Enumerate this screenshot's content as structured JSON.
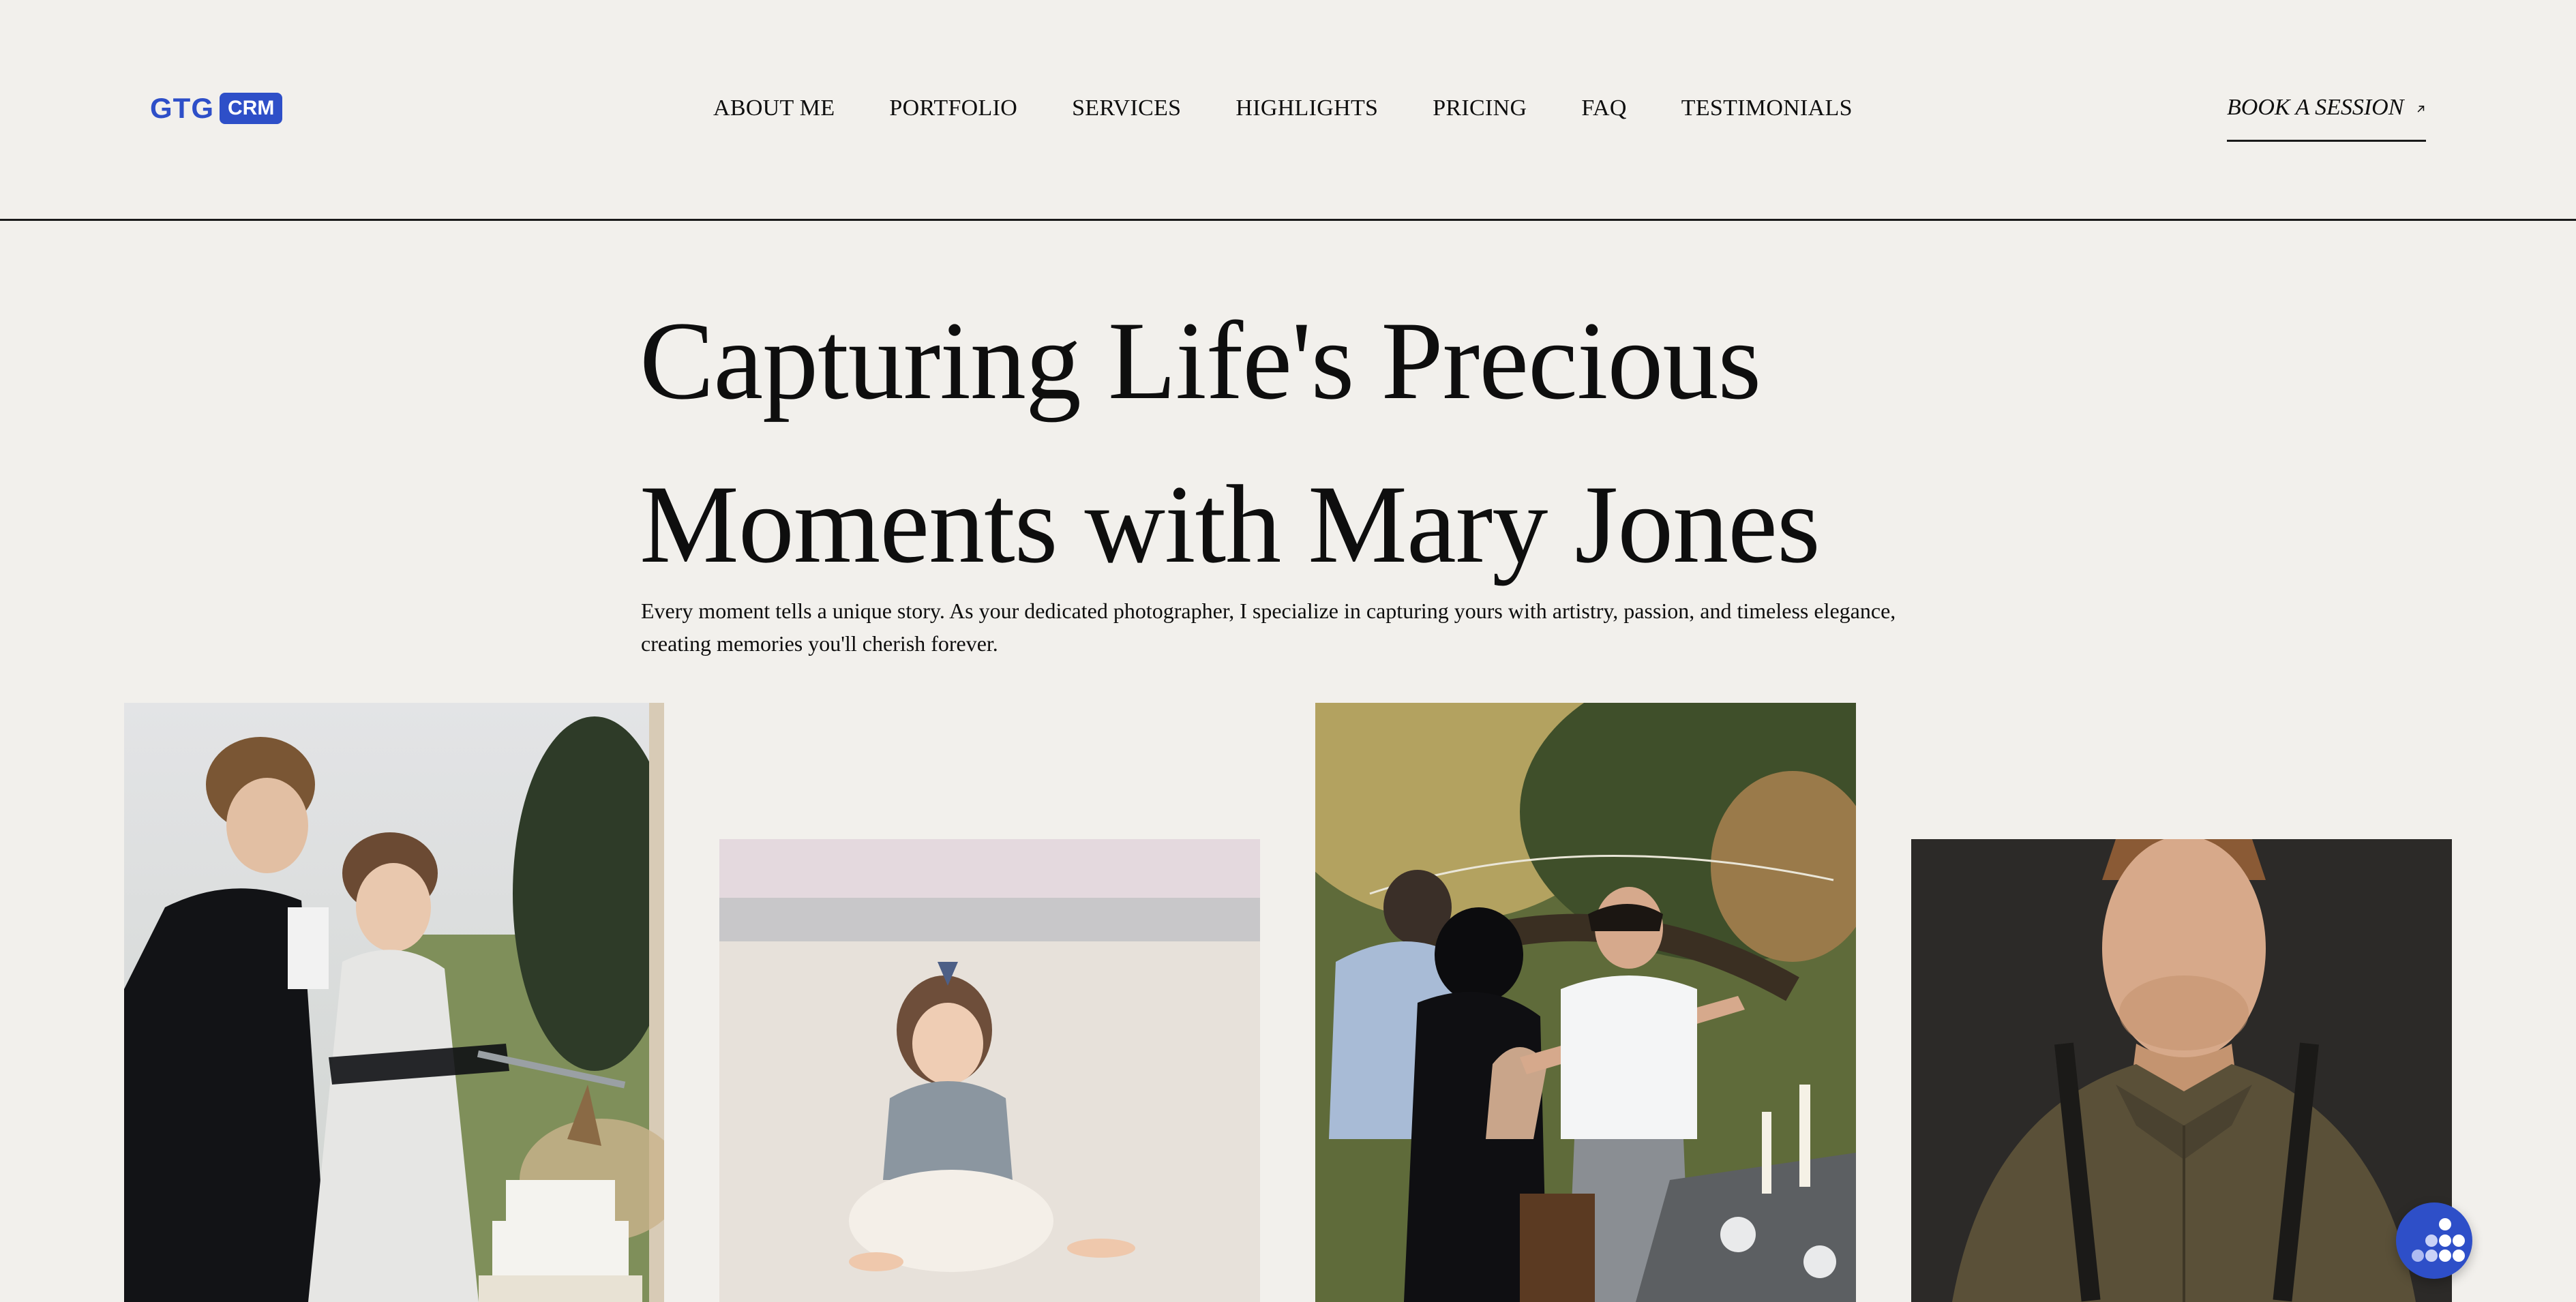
{
  "logo": {
    "brand": "GTG",
    "badge": "CRM"
  },
  "nav": {
    "items": [
      {
        "label": "ABOUT ME"
      },
      {
        "label": "PORTFOLIO"
      },
      {
        "label": "SERVICES"
      },
      {
        "label": "HIGHLIGHTS"
      },
      {
        "label": "PRICING"
      },
      {
        "label": "FAQ"
      },
      {
        "label": "TESTIMONIALS"
      }
    ]
  },
  "cta": {
    "label": "BOOK A SESSION",
    "icon": "arrow-up-right-icon"
  },
  "hero": {
    "title_line1": "Capturing Life's Precious",
    "title_line2": "Moments with Mary Jones",
    "subtitle_line1": "Every moment tells a unique story. As your dedicated photographer, I specialize in capturing yours with artistry, passion, and timeless elegance,",
    "subtitle_line2": "creating memories you'll cherish forever."
  },
  "gallery": {
    "photos": [
      {
        "subject": "wedding-couple-cutting-cake"
      },
      {
        "subject": "toddler-on-beach"
      },
      {
        "subject": "friends-celebrating-outdoor-dinner"
      },
      {
        "subject": "man-portrait-with-suspenders"
      }
    ]
  },
  "widget": {
    "icon": "dots-grid-icon"
  },
  "colors": {
    "background": "#f2f0ec",
    "brand_blue": "#2e4fc8",
    "text": "#0e0e0e"
  }
}
